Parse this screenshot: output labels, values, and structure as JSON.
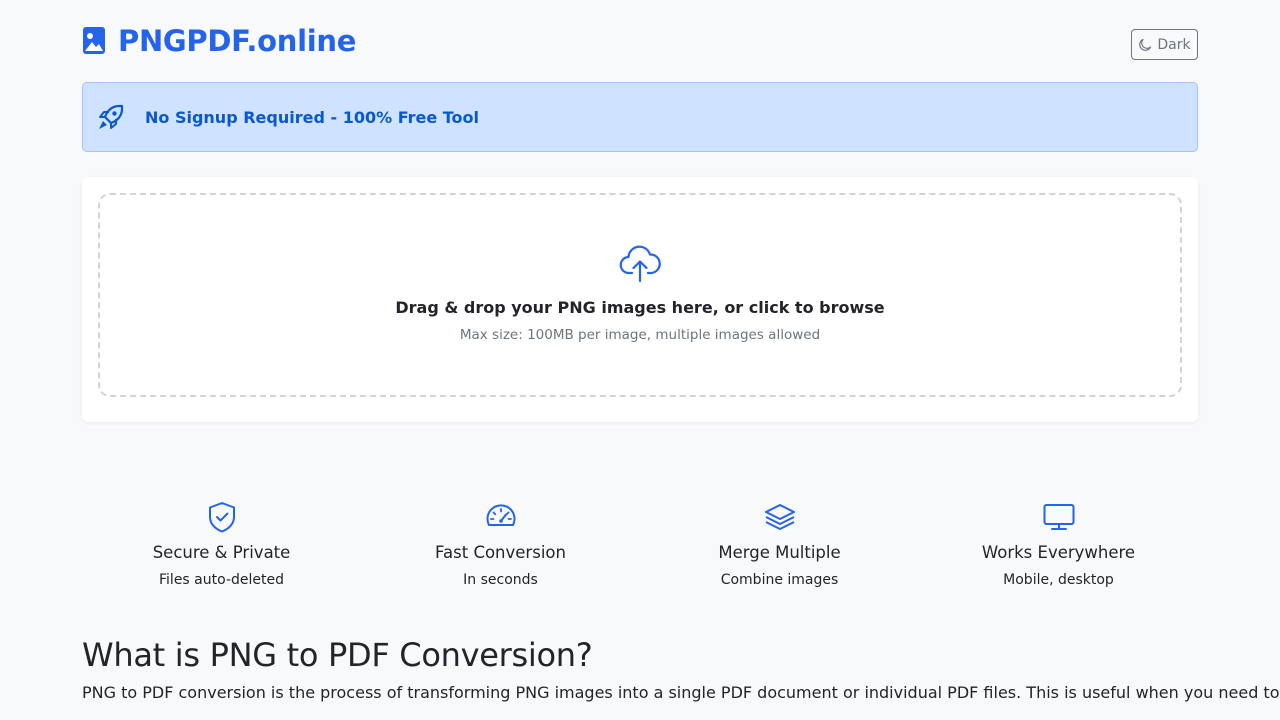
{
  "header": {
    "logo_text": "PNGPDF.online",
    "theme_button_label": "Dark",
    "brand_color": "#2563eb"
  },
  "banner": {
    "text": "No Signup Required - 100% Free Tool",
    "icon": "rocket-icon"
  },
  "upload": {
    "title": "Drag & drop your PNG images here, or click to browse",
    "subtitle": "Max size: 100MB per image, multiple images allowed",
    "icon": "cloud-upload-icon"
  },
  "features": [
    {
      "icon": "shield-check-icon",
      "title": "Secure & Private",
      "subtitle": "Files auto-deleted"
    },
    {
      "icon": "speedometer-icon",
      "title": "Fast Conversion",
      "subtitle": "In seconds"
    },
    {
      "icon": "layers-icon",
      "title": "Merge Multiple",
      "subtitle": "Combine images"
    },
    {
      "icon": "monitor-icon",
      "title": "Works Everywhere",
      "subtitle": "Mobile, desktop"
    }
  ],
  "about": {
    "title": "What is PNG to PDF Conversion?",
    "text": "PNG to PDF conversion is the process of transforming PNG images into a single PDF document or individual PDF files. This is useful when you need to"
  }
}
